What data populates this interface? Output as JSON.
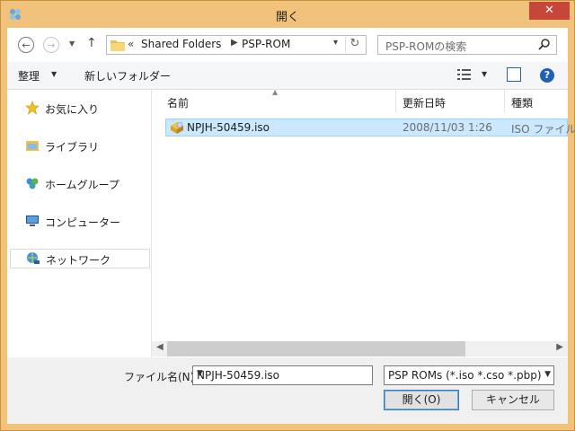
{
  "window": {
    "title": "開く",
    "close": "✕"
  },
  "nav": {
    "back": "←",
    "forward": "→",
    "up": "↑",
    "breadcrumb_chevron": "«",
    "breadcrumb": [
      "Shared Folders",
      "PSP-ROM"
    ],
    "search_placeholder": "PSP-ROMの検索"
  },
  "toolbar": {
    "organize": "整理",
    "new_folder": "新しいフォルダー"
  },
  "sidebar": {
    "items": [
      {
        "label": "お気に入り",
        "icon": "star-icon"
      },
      {
        "label": "ライブラリ",
        "icon": "library-icon"
      },
      {
        "label": "ホームグループ",
        "icon": "homegroup-icon"
      },
      {
        "label": "コンピューター",
        "icon": "computer-icon"
      },
      {
        "label": "ネットワーク",
        "icon": "network-icon"
      }
    ]
  },
  "columns": {
    "name": "名前",
    "date": "更新日時",
    "type": "種類"
  },
  "files": [
    {
      "name": "NPJH-50459.iso",
      "date": "2008/11/03 1:26",
      "type": "ISO ファイル"
    }
  ],
  "bottom": {
    "filename_label": "ファイル名(N):",
    "filename_value": "NPJH-50459.iso",
    "filter": "PSP ROMs (*.iso *.cso *.pbp)",
    "open": "開く(O)",
    "cancel": "キャンセル"
  },
  "colors": {
    "frame": "#f0c27c",
    "selection": "#cce8ff",
    "close": "#c7463a"
  }
}
